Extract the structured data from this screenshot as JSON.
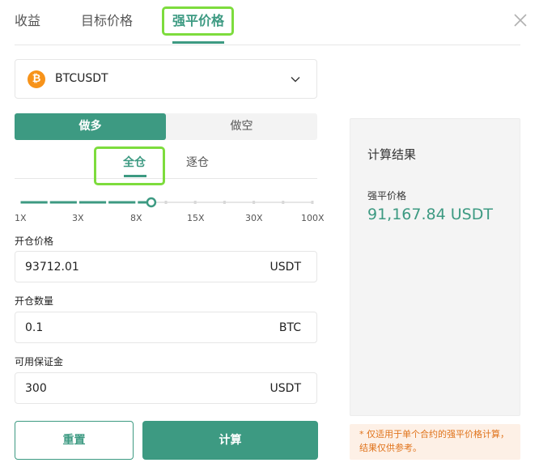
{
  "tabs": [
    {
      "label": "收益"
    },
    {
      "label": "目标价格"
    },
    {
      "label": "强平价格"
    }
  ],
  "symbol": {
    "value": "BTCUSDT",
    "icon": "bitcoin-icon",
    "icon_glyph": "₿"
  },
  "side": {
    "long_label": "做多",
    "short_label": "做空",
    "selected": "long"
  },
  "margin_mode": {
    "cross_label": "全仓",
    "isolated_label": "逐仓",
    "selected": "cross"
  },
  "leverage": {
    "labels": [
      "1X",
      "3X",
      "8X",
      "15X",
      "30X",
      "100X"
    ],
    "current_position": 0.45
  },
  "form": {
    "entry_price": {
      "label": "开仓价格",
      "value": "93712.01",
      "unit": "USDT"
    },
    "quantity": {
      "label": "开仓数量",
      "value": "0.1",
      "unit": "BTC"
    },
    "margin": {
      "label": "可用保证金",
      "value": "300",
      "unit": "USDT"
    }
  },
  "buttons": {
    "reset": "重置",
    "calculate": "计算"
  },
  "result": {
    "title": "计算结果",
    "liq_label": "强平价格",
    "liq_value": "91,167.84 USDT"
  },
  "note": "* 仅适用于单个合约的强平价格计算，结果仅供参考。",
  "colors": {
    "accent": "#3d9a82",
    "highlight": "#7ddc3d",
    "note_text": "#e0731b",
    "note_bg": "#fdf0e6",
    "bitcoin": "#f7931a"
  }
}
